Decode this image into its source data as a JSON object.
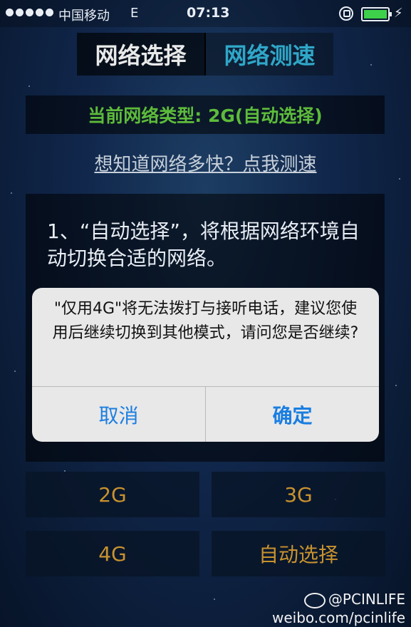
{
  "status_bar": {
    "carrier": "中国移动",
    "network_type": "E",
    "time": "07:13",
    "icons": [
      "signal-dots-icon",
      "rotation-lock-icon",
      "battery-icon",
      "charging-icon"
    ]
  },
  "tabs": [
    {
      "label": "网络选择",
      "active": true
    },
    {
      "label": "网络测速",
      "active": false
    }
  ],
  "current_network": "当前网络类型: 2G(自动选择)",
  "speed_test_link": "想知道网络多快？点我测速",
  "info_text": "1、“自动选择”，将根据网络环境自动切换合适的网络。",
  "network_buttons": [
    "2G",
    "3G",
    "4G",
    "自动选择"
  ],
  "alert": {
    "message": "\"仅用4G\"将无法拨打与接听电话，建议您使用后继续切换到其他模式，请问您是否继续?",
    "cancel": "取消",
    "confirm": "确定"
  },
  "watermark": {
    "handle": "@PCINLIFE",
    "url": "weibo.com/pcinlife"
  },
  "colors": {
    "tab_inactive": "#2fa7c8",
    "current_network": "#5dbb3a",
    "network_button_text": "#c8922e",
    "alert_button": "#1a7ee0"
  }
}
